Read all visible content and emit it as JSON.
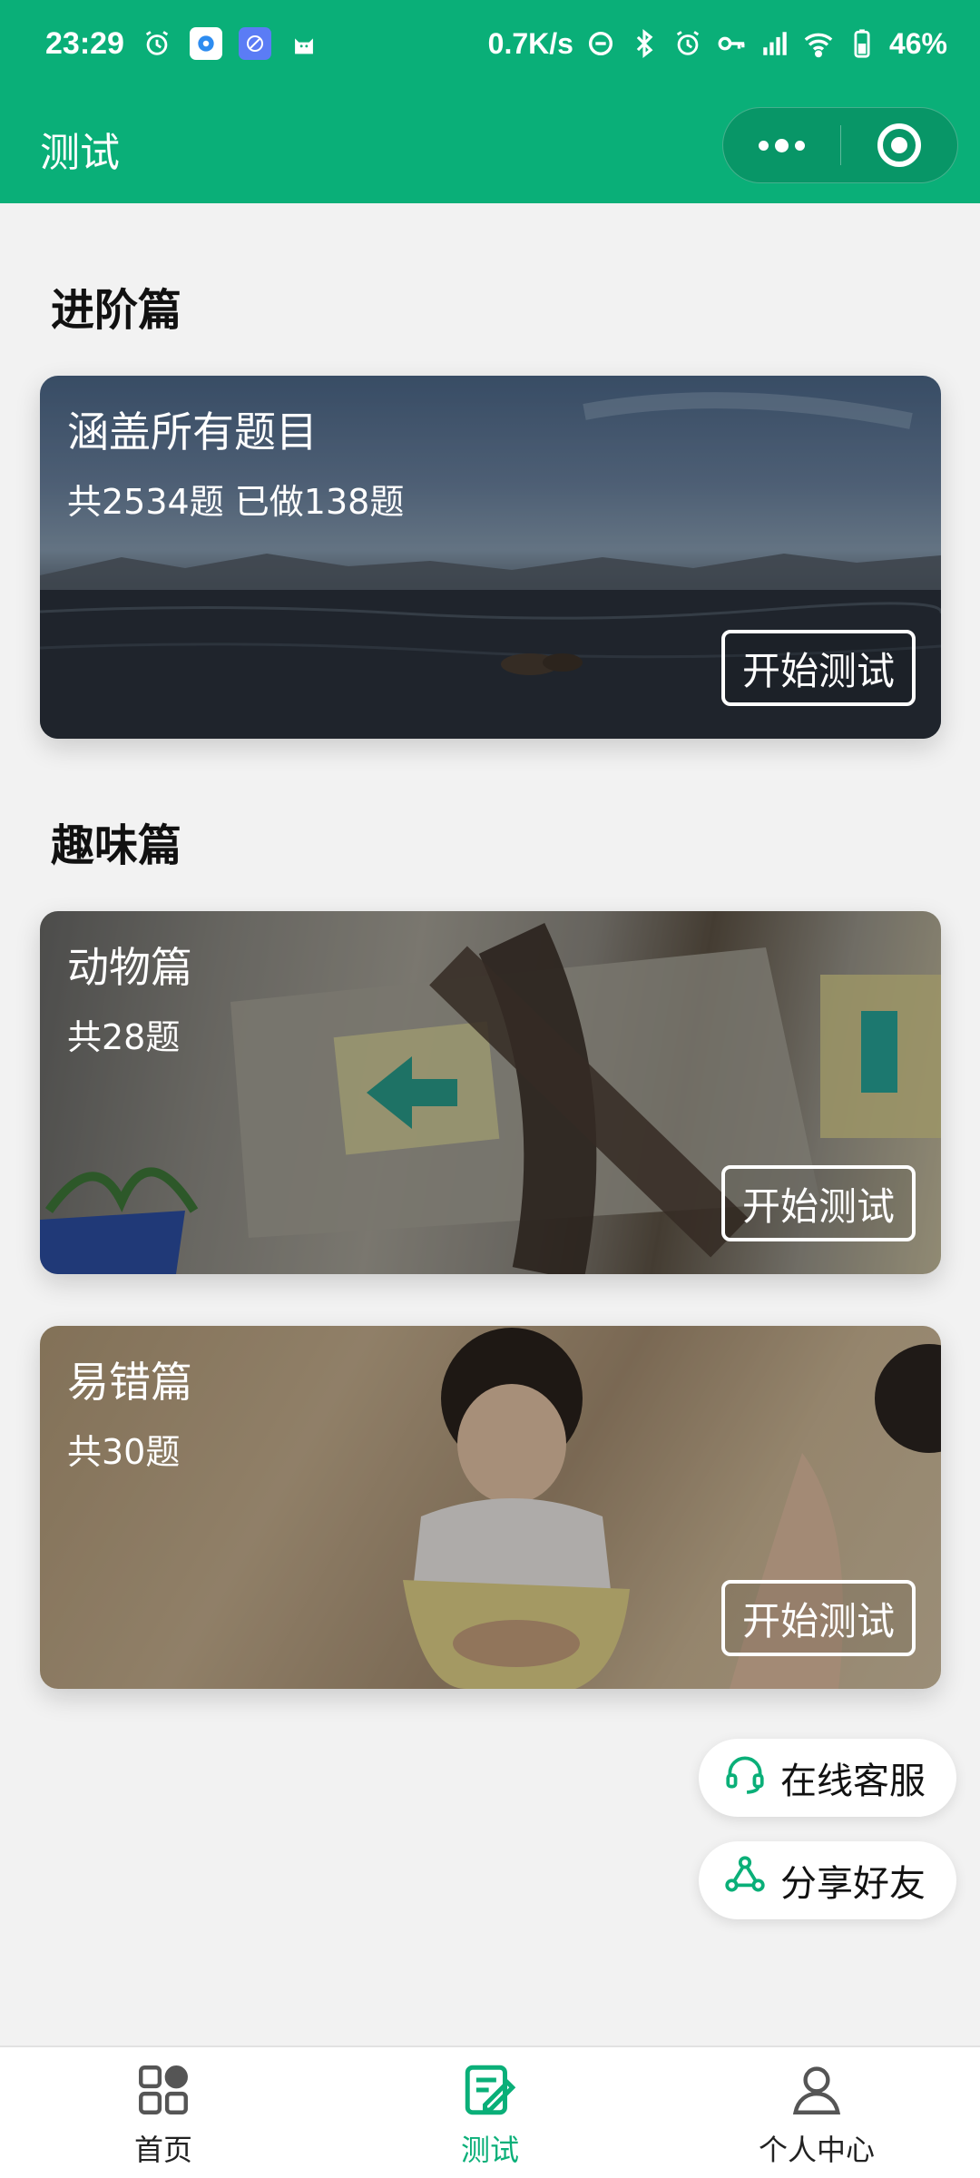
{
  "status_bar": {
    "time": "23:29",
    "net_speed": "0.7K/s",
    "battery": "46%"
  },
  "nav": {
    "title": "测试"
  },
  "sections": {
    "advanced": {
      "title": "进阶篇"
    },
    "fun": {
      "title": "趣味篇"
    }
  },
  "cards": {
    "all": {
      "title": "涵盖所有题目",
      "subtitle": "共2534题 已做138题",
      "button": "开始测试"
    },
    "animals": {
      "title": "动物篇",
      "subtitle": "共28题",
      "button": "开始测试"
    },
    "mistakes": {
      "title": "易错篇",
      "subtitle": "共30题",
      "button": "开始测试"
    }
  },
  "floating": {
    "service": "在线客服",
    "share": "分享好友"
  },
  "tabbar": {
    "home": "首页",
    "test": "测试",
    "profile": "个人中心"
  },
  "colors": {
    "brand": "#0aaf78",
    "background": "#f2f2f2"
  }
}
